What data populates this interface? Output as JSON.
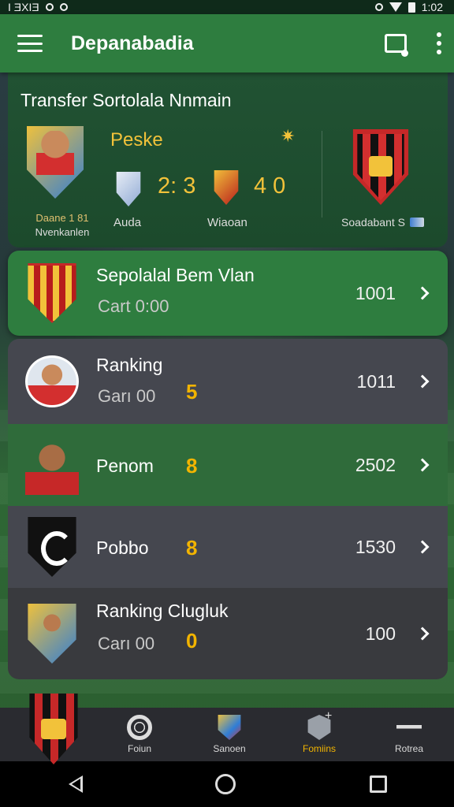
{
  "status_bar": {
    "time": "1:02",
    "left_glyphs": "I ƎXIƎ"
  },
  "app_bar": {
    "title": "Depanabadia"
  },
  "match_card": {
    "title": "Transfer Sortolala Nnmain",
    "left_caption_line1": "Daane 1 81",
    "left_caption_line2": "Nvenkanlen",
    "highlight_label": "Peske",
    "score_a": "2: 3",
    "score_b": "4  0",
    "team_a_caption": "Auda",
    "team_b_caption": "Wiaoan",
    "right_caption": "Soadabant S"
  },
  "list": [
    {
      "title": "Sepolalal Bem Vlan",
      "subtitle": "Cart 0:00",
      "count": "",
      "value": "1001",
      "style": "highlight"
    },
    {
      "title": "Ranking",
      "subtitle": "Garı 00",
      "count": "5",
      "value": "1011",
      "style": "gray"
    },
    {
      "title": "Penom",
      "subtitle": "",
      "count": "8",
      "value": "2502",
      "style": "green"
    },
    {
      "title": "Pobbo",
      "subtitle": "",
      "count": "8",
      "value": "1530",
      "style": "gray"
    },
    {
      "title": "Ranking Clugluk",
      "subtitle": "Carı 00",
      "count": "0",
      "value": "100",
      "style": "dark"
    }
  ],
  "bottom_nav": [
    {
      "label": "Foiun",
      "icon": "target-icon"
    },
    {
      "label": "Sanoen",
      "icon": "shield-icon"
    },
    {
      "label": "Fomiins",
      "icon": "badge-icon",
      "active": true
    },
    {
      "label": "Rotrea",
      "icon": "runner-icon"
    }
  ],
  "colors": {
    "accent": "#2e7d3f",
    "highlight_text": "#f2b400",
    "dark_row": "#393a3e",
    "gray_row": "#45474f"
  }
}
